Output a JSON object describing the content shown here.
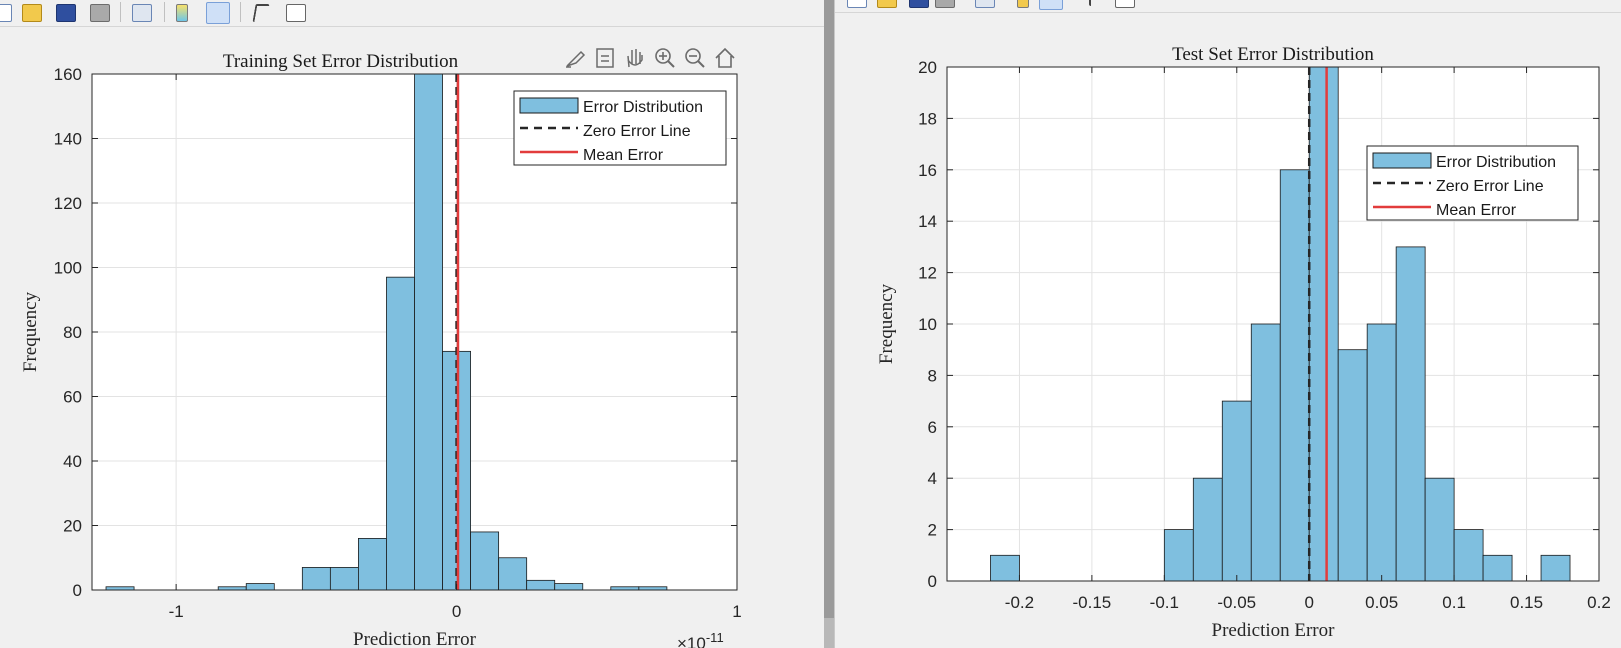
{
  "colors": {
    "bar_fill": "#7fbfdf",
    "bar_edge": "#1a1a1a",
    "zero_line": "#262626",
    "mean_line": "#e23c3c",
    "grid": "#e3e3e3",
    "window_bg": "#f0f0f0"
  },
  "toolbar_icons": [
    "new-figure-icon",
    "open-icon",
    "save-icon",
    "print-icon",
    "link-plot-icon",
    "colorbar-icon",
    "legend-icon",
    "pointer-icon",
    "property-editor-icon"
  ],
  "axes_toolbar": [
    "brush-icon",
    "data-tips-icon",
    "pan-icon",
    "zoom-in-icon",
    "zoom-out-icon",
    "restore-view-icon"
  ],
  "left_plot": {
    "title": "Training Set Error Distribution",
    "xlabel": "Prediction Error",
    "ylabel": "Frequency",
    "x_exponent": "10",
    "x_exponent_power": "-11"
  },
  "right_plot": {
    "title": "Test Set Error Distribution",
    "xlabel": "Prediction Error",
    "ylabel": "Frequency"
  },
  "chart_data": [
    {
      "type": "bar",
      "title": "Training Set Error Distribution",
      "xlabel": "Prediction Error",
      "ylabel": "Frequency",
      "x_multiplier": "×10^-11",
      "xlim": [
        -1.3,
        1.0
      ],
      "ylim": [
        0,
        160
      ],
      "xticks": [
        -1,
        0,
        1
      ],
      "xtick_labels": [
        "-1",
        "0",
        "1"
      ],
      "yticks": [
        0,
        20,
        40,
        60,
        80,
        100,
        120,
        140,
        160
      ],
      "ytick_labels": [
        "0",
        "20",
        "40",
        "60",
        "80",
        "100",
        "120",
        "140",
        "160"
      ],
      "bin_width": 0.1,
      "bins": [
        {
          "x0": -1.25,
          "x1": -1.15,
          "count": 1
        },
        {
          "x0": -0.85,
          "x1": -0.75,
          "count": 1
        },
        {
          "x0": -0.75,
          "x1": -0.65,
          "count": 2
        },
        {
          "x0": -0.55,
          "x1": -0.45,
          "count": 7
        },
        {
          "x0": -0.45,
          "x1": -0.35,
          "count": 7
        },
        {
          "x0": -0.35,
          "x1": -0.25,
          "count": 16
        },
        {
          "x0": -0.25,
          "x1": -0.15,
          "count": 97
        },
        {
          "x0": -0.15,
          "x1": -0.05,
          "count": 165
        },
        {
          "x0": -0.05,
          "x1": 0.05,
          "count": 74
        },
        {
          "x0": 0.05,
          "x1": 0.15,
          "count": 18
        },
        {
          "x0": 0.15,
          "x1": 0.25,
          "count": 10
        },
        {
          "x0": 0.25,
          "x1": 0.35,
          "count": 3
        },
        {
          "x0": 0.35,
          "x1": 0.45,
          "count": 2
        },
        {
          "x0": 0.55,
          "x1": 0.65,
          "count": 1
        },
        {
          "x0": 0.65,
          "x1": 0.75,
          "count": 1
        }
      ],
      "zero_line_x": 0,
      "mean_error_x": 0.005,
      "grid": true,
      "legend": {
        "placement": "top-right",
        "entries": [
          "Error Distribution",
          "Zero Error Line",
          "Mean Error"
        ]
      }
    },
    {
      "type": "bar",
      "title": "Test Set Error Distribution",
      "xlabel": "Prediction Error",
      "ylabel": "Frequency",
      "xlim": [
        -0.25,
        0.2
      ],
      "ylim": [
        0,
        20
      ],
      "xticks": [
        -0.2,
        -0.15,
        -0.1,
        -0.05,
        0,
        0.05,
        0.1,
        0.15,
        0.2
      ],
      "xtick_labels": [
        "-0.2",
        "-0.15",
        "-0.1",
        "-0.05",
        "0",
        "0.05",
        "0.1",
        "0.15",
        "0.2"
      ],
      "yticks": [
        0,
        2,
        4,
        6,
        8,
        10,
        12,
        14,
        16,
        18,
        20
      ],
      "ytick_labels": [
        "0",
        "2",
        "4",
        "6",
        "8",
        "10",
        "12",
        "14",
        "16",
        "18",
        "20"
      ],
      "bin_width": 0.02,
      "bins": [
        {
          "x0": -0.22,
          "x1": -0.2,
          "count": 1
        },
        {
          "x0": -0.1,
          "x1": -0.08,
          "count": 2
        },
        {
          "x0": -0.08,
          "x1": -0.06,
          "count": 4
        },
        {
          "x0": -0.06,
          "x1": -0.04,
          "count": 7
        },
        {
          "x0": -0.04,
          "x1": -0.02,
          "count": 10
        },
        {
          "x0": -0.02,
          "x1": 0.0,
          "count": 16
        },
        {
          "x0": 0.0,
          "x1": 0.02,
          "count": 21
        },
        {
          "x0": 0.02,
          "x1": 0.04,
          "count": 9
        },
        {
          "x0": 0.04,
          "x1": 0.06,
          "count": 10
        },
        {
          "x0": 0.06,
          "x1": 0.08,
          "count": 13
        },
        {
          "x0": 0.08,
          "x1": 0.1,
          "count": 4
        },
        {
          "x0": 0.1,
          "x1": 0.12,
          "count": 2
        },
        {
          "x0": 0.12,
          "x1": 0.14,
          "count": 1
        },
        {
          "x0": 0.16,
          "x1": 0.18,
          "count": 1
        }
      ],
      "zero_line_x": 0,
      "mean_error_x": 0.012,
      "grid": true,
      "legend": {
        "placement": "top-right",
        "entries": [
          "Error Distribution",
          "Zero Error Line",
          "Mean Error"
        ]
      }
    }
  ]
}
